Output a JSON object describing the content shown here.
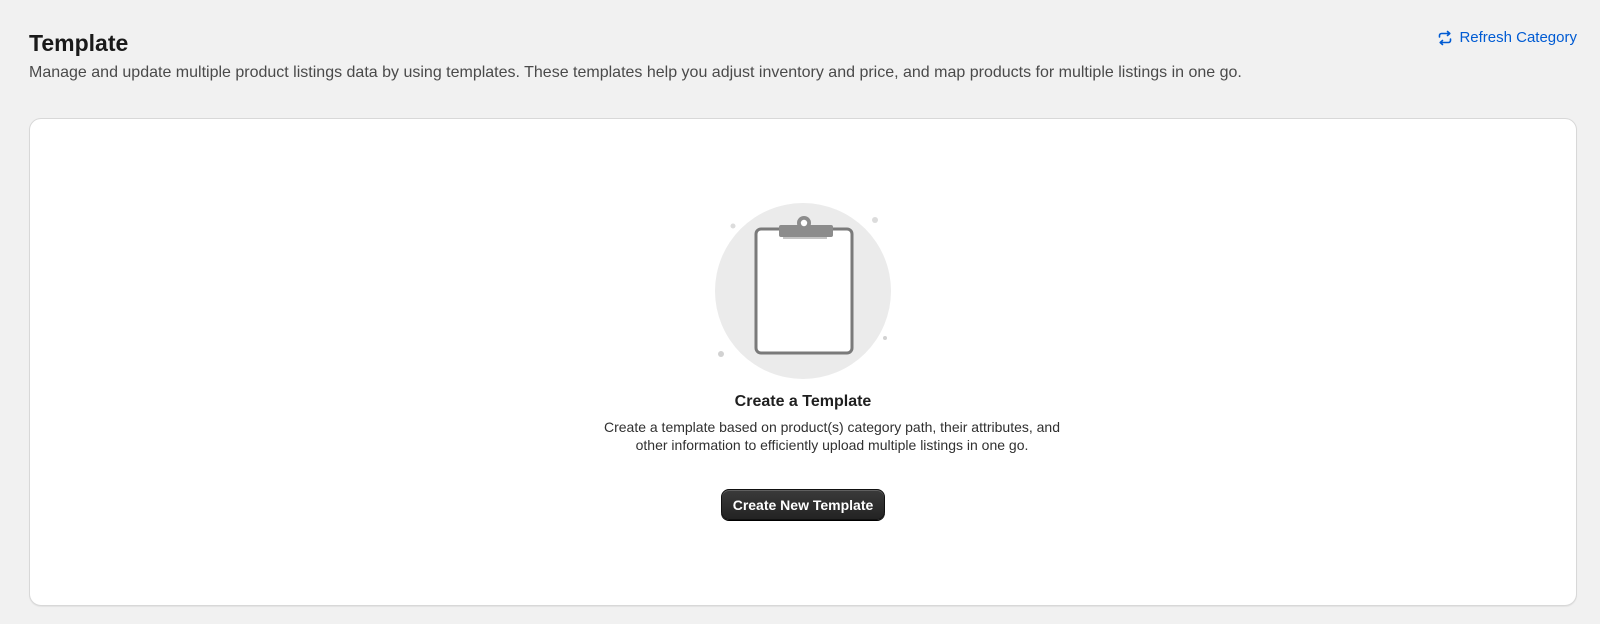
{
  "header": {
    "title": "Template",
    "subtitle": "Manage and update multiple product listings data by using templates. These templates help you adjust inventory and price, and map products for multiple listings in one go.",
    "refresh_label": "Refresh Category",
    "refresh_icon": "refresh-icon"
  },
  "empty_state": {
    "illustration": "clipboard-icon",
    "heading": "Create a Template",
    "body": "Create a template based on product(s) category path, their attributes, and other information to efficiently upload multiple listings in one go.",
    "button_label": "Create New Template"
  },
  "colors": {
    "background": "#f1f1f1",
    "link": "#005bd3",
    "primary_button": "#303030",
    "card": "#ffffff"
  }
}
